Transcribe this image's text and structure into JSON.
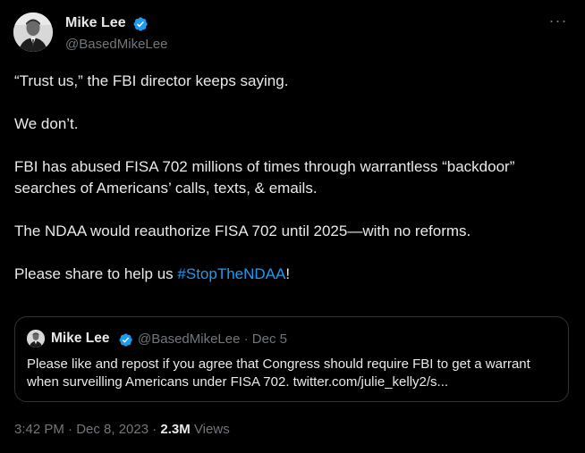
{
  "author": {
    "name": "Mike Lee",
    "handle": "@BasedMikeLee",
    "verified_color": "#1d9bf0"
  },
  "icons": {
    "avatar": "avatar-photo",
    "verified": "verified-badge-icon",
    "more": "more-options-icon"
  },
  "more_glyph": "···",
  "tweet": {
    "paragraphs": [
      "“Trust us,” the FBI director keeps saying.",
      "We don’t.",
      "FBI has abused FISA 702 millions of times through warrantless “backdoor” searches of Americans’ calls, texts, & emails.",
      "The NDAA would reauthorize FISA 702 until 2025—with no reforms."
    ],
    "last_prefix": "Please share to help us ",
    "hashtag": "#StopTheNDAA",
    "last_suffix": "!"
  },
  "quote": {
    "name": "Mike Lee",
    "handle_date": "@BasedMikeLee · Dec 5",
    "text": "Please like and repost if you agree that Congress should require FBI to get a warrant when surveilling Americans under FISA 702. twitter.com/julie_kelly2/s..."
  },
  "meta": {
    "time_date": "3:42 PM · Dec 8, 2023 · ",
    "views_count": "2.3M",
    "views_label": " Views"
  },
  "colors": {
    "background": "#000000",
    "text": "#e7e9ea",
    "secondary": "#71767b",
    "link": "#1d9bf0",
    "border": "#2f3336"
  }
}
